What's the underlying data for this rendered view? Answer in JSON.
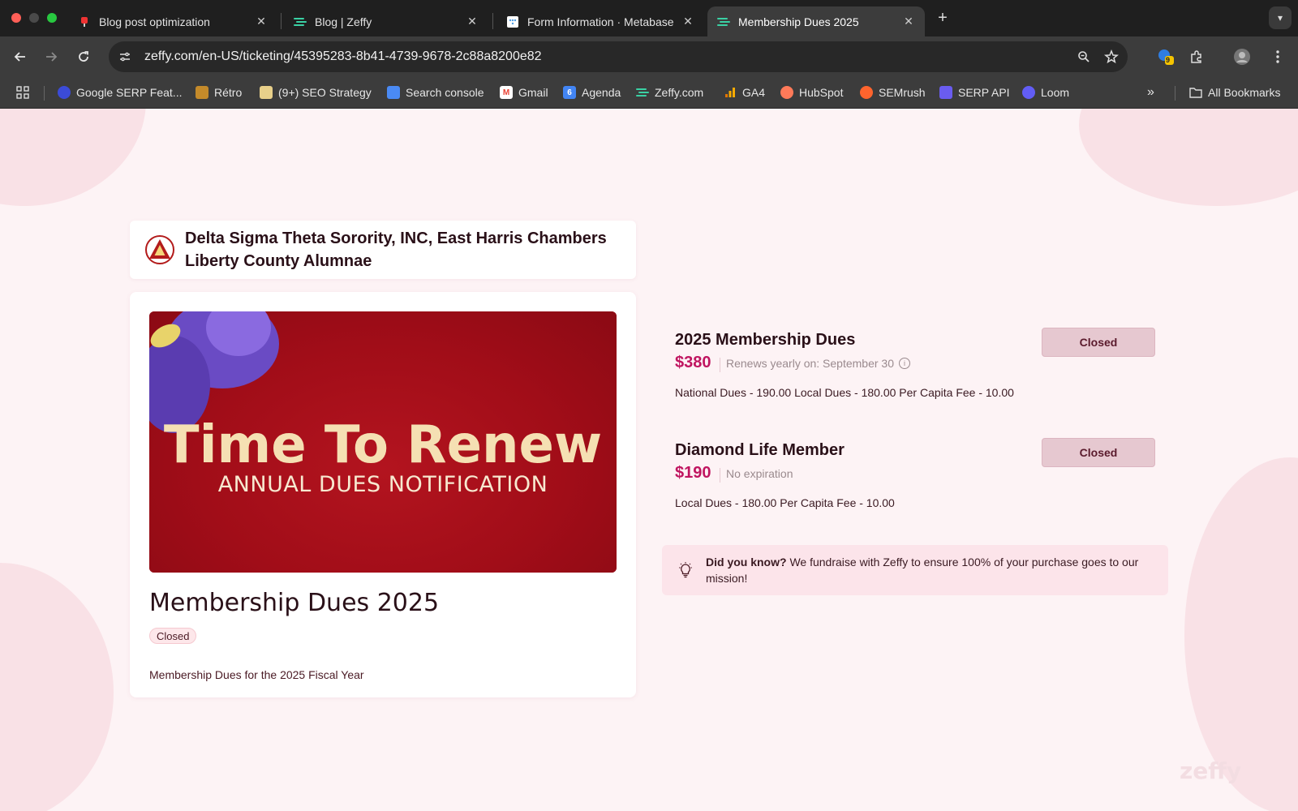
{
  "browser": {
    "tabs": [
      {
        "title": "Blog post optimization",
        "icon": "pin-favicon",
        "active": false
      },
      {
        "title": "Blog | Zeffy",
        "icon": "zeffy-favicon",
        "active": false
      },
      {
        "title": "Form Information · Metabase",
        "icon": "metabase-favicon",
        "active": false
      },
      {
        "title": "Membership Dues 2025",
        "icon": "zeffy-favicon",
        "active": true
      }
    ],
    "url": "zeffy.com/en-US/ticketing/45395283-8b41-4739-9678-2c88a8200e82",
    "extension_badge": "9",
    "bookmarks": [
      {
        "label": "Google SERP Feat...",
        "icon": "google-serp-icon",
        "color": "#3b4bd8"
      },
      {
        "label": "Rétro",
        "icon": "retro-icon",
        "color": "#c48a2a"
      },
      {
        "label": "(9+) SEO Strategy",
        "icon": "notion-icon",
        "color": "#e8d08a"
      },
      {
        "label": "Search console",
        "icon": "search-console-icon",
        "color": "#4a8af4"
      },
      {
        "label": "Gmail",
        "icon": "gmail-icon",
        "color": "#ea4335"
      },
      {
        "label": "Agenda",
        "icon": "calendar-icon",
        "color": "#4285f4"
      },
      {
        "label": "Zeffy.com",
        "icon": "zeffy-icon",
        "color": "#3ad1a4"
      },
      {
        "label": "GA4",
        "icon": "analytics-icon",
        "color": "#f9ab00"
      },
      {
        "label": "HubSpot",
        "icon": "hubspot-icon",
        "color": "#ff7a59"
      },
      {
        "label": "SEMrush",
        "icon": "semrush-icon",
        "color": "#ff642d"
      },
      {
        "label": "SERP API",
        "icon": "serp-api-icon",
        "color": "#6a5cf0"
      },
      {
        "label": "Loom",
        "icon": "loom-icon",
        "color": "#625df5"
      }
    ],
    "all_bookmarks_label": "All Bookmarks"
  },
  "org": {
    "name": "Delta Sigma Theta Sorority, INC, East Harris Chambers Liberty County Alumnae"
  },
  "form": {
    "banner_title": "Time To Renew",
    "banner_subtitle": "ANNUAL DUES NOTIFICATION",
    "title": "Membership Dues 2025",
    "status": "Closed",
    "description": "Membership Dues for the 2025 Fiscal Year"
  },
  "rates": [
    {
      "name": "2025 Membership Dues",
      "price": "$380",
      "meta": "Renews yearly on: September 30",
      "details": "National Dues - 190.00 Local Dues - 180.00 Per Capita Fee - 10.00",
      "button": "Closed"
    },
    {
      "name": "Diamond Life Member",
      "price": "$190",
      "meta": "No expiration",
      "details": "Local Dues - 180.00 Per Capita Fee - 10.00",
      "button": "Closed"
    }
  ],
  "did_you_know": {
    "lead": "Did you know?",
    "text": " We fundraise with Zeffy to ensure 100% of your purchase goes to our mission!"
  },
  "watermark": "zeffy",
  "colors": {
    "accent": "#c01560",
    "page_bg": "#fdf3f5",
    "banner_red": "#a10d18"
  }
}
